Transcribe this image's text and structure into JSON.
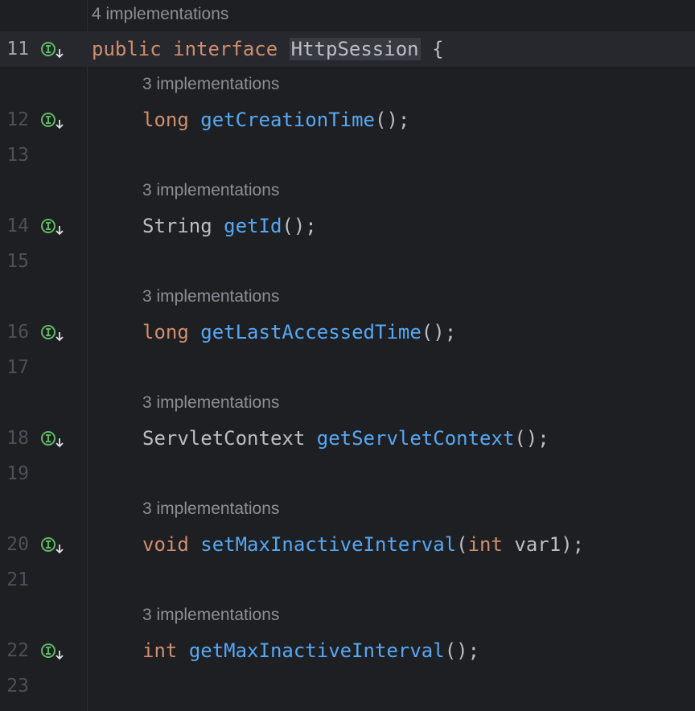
{
  "colors": {
    "background": "#1e1f22",
    "keyword": "#cf8e6d",
    "method": "#56a8f5",
    "text": "#bcbec4",
    "hint": "#8c8f96",
    "gutter_icon": "#5fb865"
  },
  "gutter_icon_name": "implemented-interface-arrow-down-icon",
  "interface": {
    "hint": "4 implementations",
    "line": "11",
    "kw_public": "public",
    "kw_interface": "interface",
    "name": "HttpSession",
    "brace": "{"
  },
  "methods": [
    {
      "hint": "3 implementations",
      "line": "12",
      "type": "long",
      "name": "getCreationTime",
      "params": "();",
      "blank_line": "13"
    },
    {
      "hint": "3 implementations",
      "line": "14",
      "type": "String",
      "name": "getId",
      "params": "();",
      "blank_line": "15"
    },
    {
      "hint": "3 implementations",
      "line": "16",
      "type": "long",
      "name": "getLastAccessedTime",
      "params": "();",
      "blank_line": "17"
    },
    {
      "hint": "3 implementations",
      "line": "18",
      "type": "ServletContext",
      "name": "getServletContext",
      "params": "();",
      "blank_line": "19"
    },
    {
      "hint": "3 implementations",
      "line": "20",
      "type": "void",
      "name": "setMaxInactiveInterval",
      "param_open": "(",
      "param_type": "int",
      "param_name": " var1",
      "param_close": ");",
      "blank_line": "21"
    },
    {
      "hint": "3 implementations",
      "line": "22",
      "type": "int",
      "name": "getMaxInactiveInterval",
      "params": "();",
      "blank_line": "23"
    }
  ]
}
